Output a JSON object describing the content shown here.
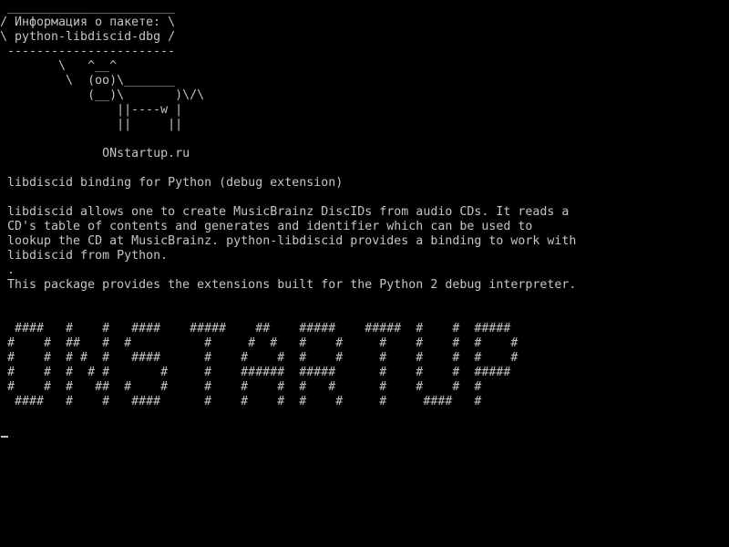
{
  "screen": {
    "background": "#000000",
    "text_color": "#c4c4c4"
  },
  "cowsay": {
    "border_top": " _______________________",
    "title_line": "/ Информация о пакете: \\",
    "package_line": "\\ python-libdiscid-dbg /",
    "border_bottom": " -----------------------",
    "cow": [
      "        \\   ^__^",
      "         \\  (oo)\\_______",
      "            (__)\\       )\\/\\",
      "                ||----w |",
      "                ||     ||"
    ],
    "site": "              ONstartup.ru"
  },
  "description": {
    "summary": " libdiscid binding for Python (debug extension)",
    "body": [
      " libdiscid allows one to create MusicBrainz DiscIDs from audio CDs. It reads a",
      " CD's table of contents and generates and identifier which can be used to",
      " lookup the CD at MusicBrainz. python-libdiscid provides a binding to work with",
      " libdiscid from Python.",
      " .",
      " This package provides the extensions built for the Python 2 debug interpreter."
    ]
  },
  "banner": [
    "  ####   #    #   ####    #####    ##    #####    #####  #    #  #####",
    " #    #  ##   #  #          #     #  #   #    #     #    #    #  #    #",
    " #    #  # #  #   ####      #    #    #  #    #     #    #    #  #    #",
    " #    #  #  # #       #     #    ######  #####      #    #    #  #####",
    " #    #  #   ##  #    #     #    #    #  #   #      #    #    #  #",
    "  ####   #    #   ####      #    #    #  #    #     #     ####   #"
  ]
}
